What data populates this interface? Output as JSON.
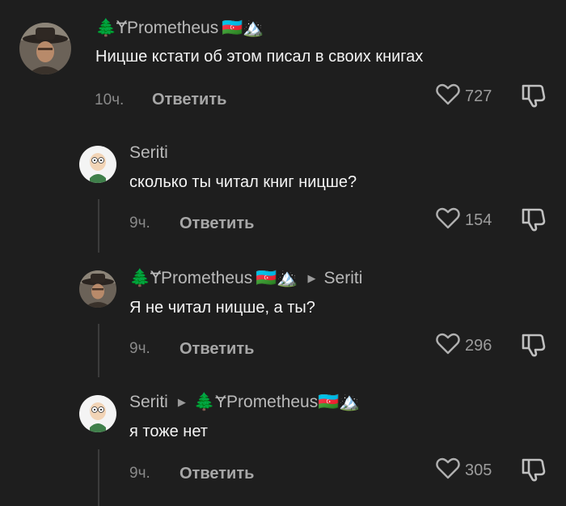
{
  "comments": [
    {
      "author_prefix": "🌲Ɏ",
      "author": "Prometheus",
      "author_badges": "🇦🇿🏔️",
      "reply_to": "",
      "text": "Ницше кстати об этом писал в своих книгах",
      "time": "10ч.",
      "reply_label": "Ответить",
      "likes": "727",
      "avatar": "cowboy"
    },
    {
      "author_prefix": "",
      "author": "Seriti",
      "author_badges": "",
      "reply_to": "",
      "text": "сколько ты читал книг ницше?",
      "time": "9ч.",
      "reply_label": "Ответить",
      "likes": "154",
      "avatar": "cartoon"
    },
    {
      "author_prefix": "🌲Ɏ",
      "author": "Prometheus",
      "author_badges": "🇦🇿🏔️",
      "reply_to": "Seriti",
      "text": "Я не читал ницше, а ты?",
      "time": "9ч.",
      "reply_label": "Ответить",
      "likes": "296",
      "avatar": "cowboy"
    },
    {
      "author_prefix": "",
      "author": "Seriti",
      "author_badges": "",
      "reply_to": "🌲ɎPrometheus🇦🇿🏔️",
      "text": "я тоже нет",
      "time": "9ч.",
      "reply_label": "Ответить",
      "likes": "305",
      "avatar": "cartoon"
    }
  ],
  "icons": {
    "like": "heart-outline-icon",
    "dislike": "thumbs-down-icon",
    "reply_arrow": "triangle-right-icon"
  },
  "colors": {
    "background": "#1e1e1e",
    "username": "#b9b9b9",
    "text": "#f4f4f4",
    "meta": "#8a8a8a"
  }
}
